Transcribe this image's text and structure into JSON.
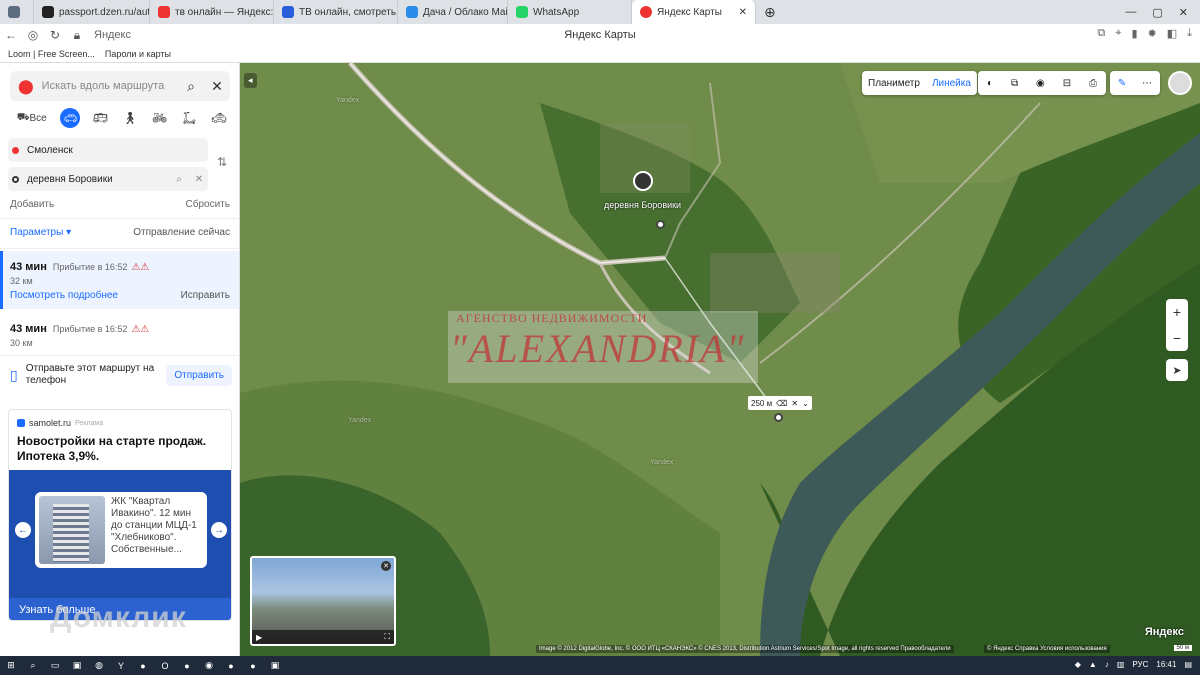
{
  "browser": {
    "tabs": [
      {
        "label": "",
        "color": "#5b6b80"
      },
      {
        "label": "passport.dzen.ru/auth/upd",
        "color": "#222"
      },
      {
        "label": "тв онлайн — Яндекс: нашл",
        "color": "#e33"
      },
      {
        "label": "ТВ онлайн, смотреть прям",
        "color": "#2a5dd8"
      },
      {
        "label": "Дача / Облако Mail.ru",
        "color": "#2a8be8"
      },
      {
        "label": "WhatsApp",
        "color": "#25d366"
      },
      {
        "label": "Яндекс Карты",
        "color": "#e33"
      }
    ],
    "site": "Яндекс",
    "page_title": "Яндекс Карты",
    "bookmarks": [
      "Loom | Free Screen...",
      "Пароли и карты"
    ]
  },
  "sidebar": {
    "search_placeholder": "Искать вдоль маршрута",
    "mode_all": "Все",
    "from": "Смоленск",
    "to": "деревня Боровики",
    "add": "Добавить",
    "reset": "Сбросить",
    "params": "Параметры ▾",
    "depart": "Отправление сейчас",
    "routes": [
      {
        "time": "43 мин",
        "arrival": "Прибытие в 16:52",
        "km": "32 км",
        "details": "Посмотреть подробнее",
        "fix": "Исправить"
      },
      {
        "time": "43 мин",
        "arrival": "Прибытие в 16:52",
        "km": "30 км"
      }
    ],
    "send_text": "Отправьте этот маршрут на телефон",
    "send_button": "Отправить"
  },
  "ad": {
    "source": "samolet.ru",
    "tag": "Реклама",
    "headline": "Новостройки на старте продаж. Ипотека 3,9%.",
    "card_text": "ЖК \"Квартал Ивакино\". 12 мин до станции МЦД-1 \"Хлебниково\". Собственные...",
    "more": "Узнать больше",
    "watermark": "Домклик"
  },
  "map": {
    "ruler_a": "Планиметр",
    "ruler_b": "Линейка",
    "place_label": "деревня Боровики",
    "watermark_line1": "АГЕНСТВО НЕДВИЖИМОСТИ",
    "watermark_line2": "\"ALEXANDRIA\"",
    "measure": "250 м",
    "copyright": "Image © 2012 DigitalGlobe, Inc. © ООО ИТЦ «СКАНЭКС» © CNES 2013, Distribution Astrium Services/Spot Image, all rights reserved   Правообладатели",
    "copyright2": "© Яндекс  Справка  Условия использования",
    "logo": "Яндекс",
    "scale": "50 м",
    "yandex_label": "Yandex",
    "colors": {
      "river": "#3d5a58",
      "forest": "#2f5a22",
      "field": "#6f8c4a",
      "road": "#c9c3b4",
      "route": "#ffffff"
    }
  },
  "taskbar": {
    "lang": "РУС",
    "clock": "16:41"
  }
}
